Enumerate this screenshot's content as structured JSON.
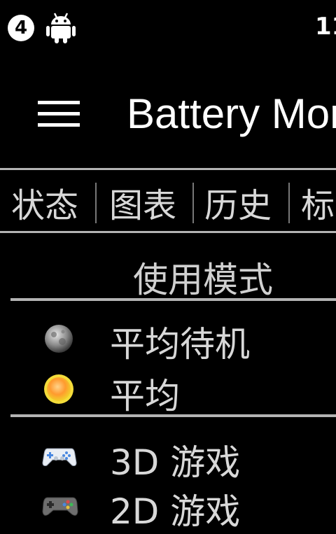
{
  "status_bar": {
    "notification_count": "4",
    "clock": "11"
  },
  "app": {
    "title": "Battery Mor"
  },
  "tabs": [
    {
      "label": "状态"
    },
    {
      "label": "图表"
    },
    {
      "label": "历史"
    },
    {
      "label": "标"
    }
  ],
  "usage_modes": {
    "title": "使用模式",
    "group1": [
      {
        "label": "平均待机",
        "icon": "moon-icon"
      },
      {
        "label": "平均",
        "icon": "sun-icon"
      }
    ],
    "group2": [
      {
        "label": "3D 游戏",
        "icon": "gamepad-3d-icon"
      },
      {
        "label": "2D 游戏",
        "icon": "gamepad-2d-icon"
      }
    ]
  },
  "colors": {
    "background": "#000000",
    "divider": "#b3b3b3",
    "text": "#d8d8d8"
  }
}
